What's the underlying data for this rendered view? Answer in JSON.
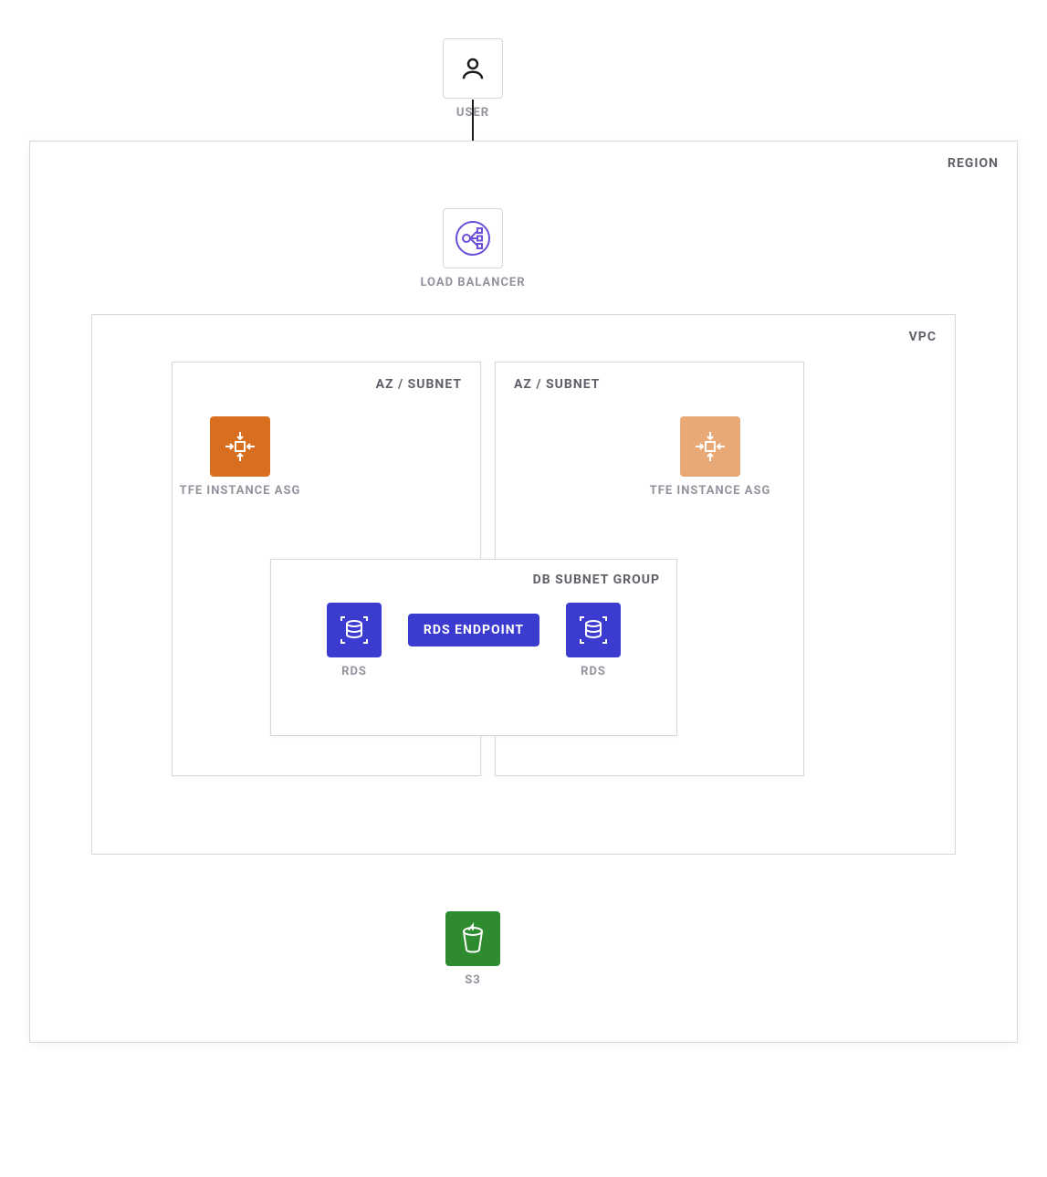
{
  "nodes": {
    "user": {
      "label": "USER"
    },
    "load_balancer": {
      "label": "LOAD BALANCER"
    },
    "tfe_left": {
      "label": "TFE INSTANCE ASG"
    },
    "tfe_right": {
      "label": "TFE INSTANCE ASG"
    },
    "rds_endpoint": {
      "label": "RDS ENDPOINT"
    },
    "rds_left": {
      "label": "RDS"
    },
    "rds_right": {
      "label": "RDS"
    },
    "s3": {
      "label": "S3"
    }
  },
  "containers": {
    "region": {
      "label": "REGION"
    },
    "vpc": {
      "label": "VPC"
    },
    "az_left": {
      "label": "AZ / SUBNET"
    },
    "az_right": {
      "label": "AZ / SUBNET"
    },
    "db_subnet": {
      "label": "DB SUBNET GROUP"
    }
  },
  "colors": {
    "orange": "#d86f1f",
    "orange_light": "#e9a977",
    "blue": "#3b3bd0",
    "green": "#2f8b2f",
    "purple": "#6c4fd8",
    "line": "#1c1c1c"
  }
}
